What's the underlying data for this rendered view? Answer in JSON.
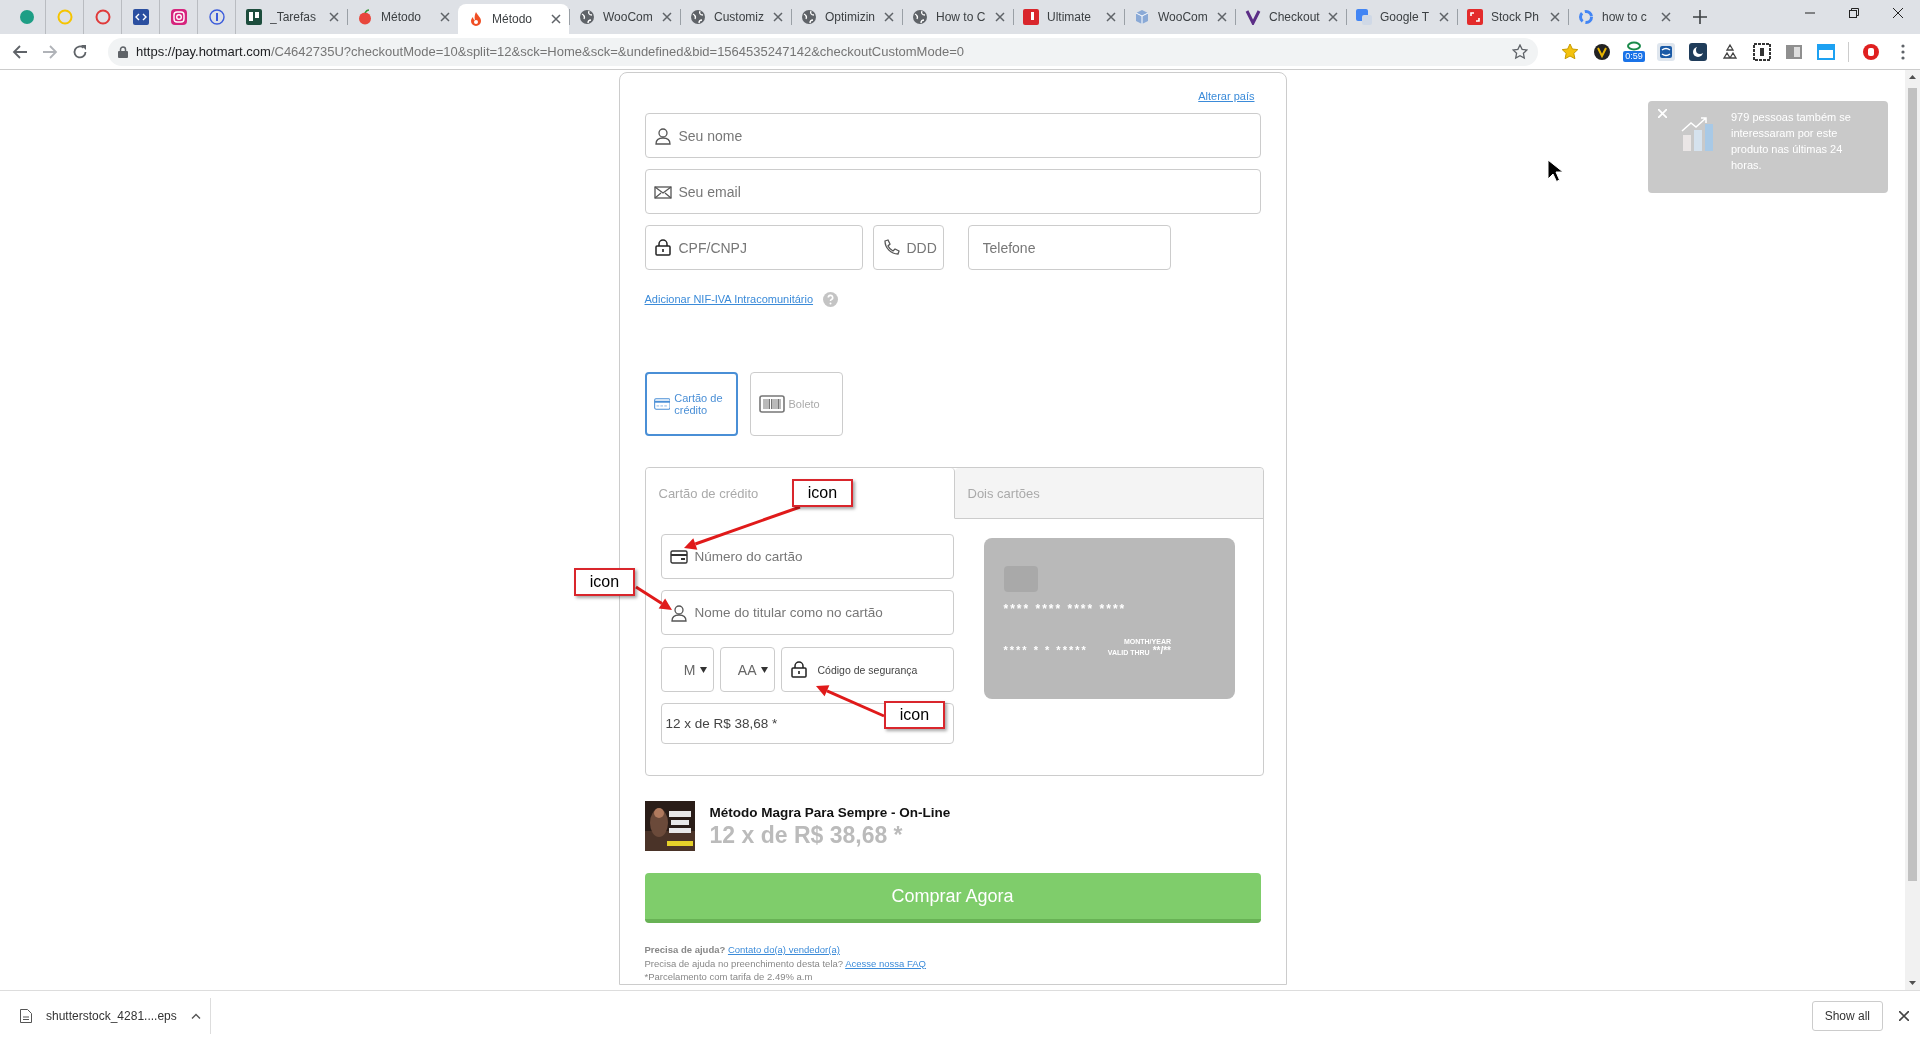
{
  "browser": {
    "tabs": [
      {
        "kind": "pinned",
        "selected": false
      },
      {
        "kind": "pinned",
        "selected": false
      },
      {
        "kind": "pinned",
        "selected": false
      },
      {
        "kind": "pinned",
        "selected": false
      },
      {
        "kind": "pinned",
        "selected": false
      },
      {
        "kind": "pinned",
        "selected": false
      },
      {
        "kind": "titled",
        "title": "_Tarefas",
        "selected": false
      },
      {
        "kind": "titled",
        "title": "Método",
        "selected": false
      },
      {
        "kind": "titled",
        "title": "Método",
        "selected": true
      },
      {
        "kind": "titled",
        "title": "WooCom",
        "selected": false
      },
      {
        "kind": "titled",
        "title": "Customiz",
        "selected": false
      },
      {
        "kind": "titled",
        "title": "Optimizin",
        "selected": false
      },
      {
        "kind": "titled",
        "title": "How to C",
        "selected": false
      },
      {
        "kind": "titled",
        "title": "Ultimate",
        "selected": false
      },
      {
        "kind": "titled",
        "title": "WooCom",
        "selected": false
      },
      {
        "kind": "titled",
        "title": "Checkout",
        "selected": false
      },
      {
        "kind": "titled",
        "title": "Google T",
        "selected": false
      },
      {
        "kind": "titled",
        "title": "Stock Ph",
        "selected": false
      },
      {
        "kind": "titled",
        "title": "how to c",
        "selected": false
      }
    ],
    "address": {
      "host": "https://pay.hotmart.com",
      "path": "/C4642735U?checkoutMode=10&split=12&sck=Home&sck=&undefined&bid=1564535247142&checkoutCustomMode=0"
    },
    "extension_badge": "0:59"
  },
  "checkout": {
    "change_country": "Alterar país",
    "fields": [
      {
        "kind": "person",
        "placeholder": "Seu nome"
      },
      {
        "kind": "email",
        "placeholder": "Seu email"
      }
    ],
    "contact_row": [
      {
        "kind": "lock",
        "placeholder": "CPF/CNPJ"
      },
      {
        "kind": "phone",
        "placeholder": "DDD"
      },
      {
        "kind": "plain",
        "placeholder": "Telefone"
      }
    ],
    "vat_link": "Adicionar NIF-IVA Intracomunitário",
    "payment_methods": [
      {
        "kind": "card",
        "label": "Cartão de crédito",
        "selected": true
      },
      {
        "kind": "boleto",
        "label": "Boleto",
        "selected": false
      }
    ],
    "card_tabs": [
      {
        "label": "Cartão de crédito",
        "selected": true
      },
      {
        "label": "Dois cartões",
        "selected": false
      }
    ],
    "card_fields": {
      "number": {
        "placeholder": "Número do cartão"
      },
      "holder": {
        "placeholder": "Nome do titular como no cartão"
      },
      "month": "M",
      "year": "AA",
      "cvv": {
        "placeholder": "Código de segurança"
      },
      "installments": "12 x de R$ 38,68 *"
    },
    "card_preview": {
      "number": "**** **** **** ****",
      "holder": "**** * * *****",
      "valid_label": "VALID THRU",
      "expiry_label": "MONTH/YEAR",
      "expiry": "**/**"
    },
    "product": {
      "title": "Método Magra Para Sempre - On-Line",
      "price": "12 x de R$ 38,68 *"
    },
    "buy_button": "Comprar Agora",
    "help": [
      {
        "text": "Precisa de ajuda?",
        "bold": true,
        "link": "Contato do(a) vendedor(a)"
      },
      {
        "text": "Precisa de ajuda no preenchimento desta tela?",
        "bold": false,
        "link": "Acesse nossa FAQ"
      },
      {
        "text": "*Parcelamento com tarifa de 2.49% a.m",
        "bold": false
      }
    ]
  },
  "notification": {
    "text": "979 pessoas também se interessaram por este produto nas últimas 24 horas."
  },
  "annotations": [
    {
      "text": "icon"
    },
    {
      "text": "icon"
    },
    {
      "text": "icon"
    }
  ],
  "download_bar": {
    "file": "shutterstock_4281....eps",
    "show_all": "Show all"
  }
}
